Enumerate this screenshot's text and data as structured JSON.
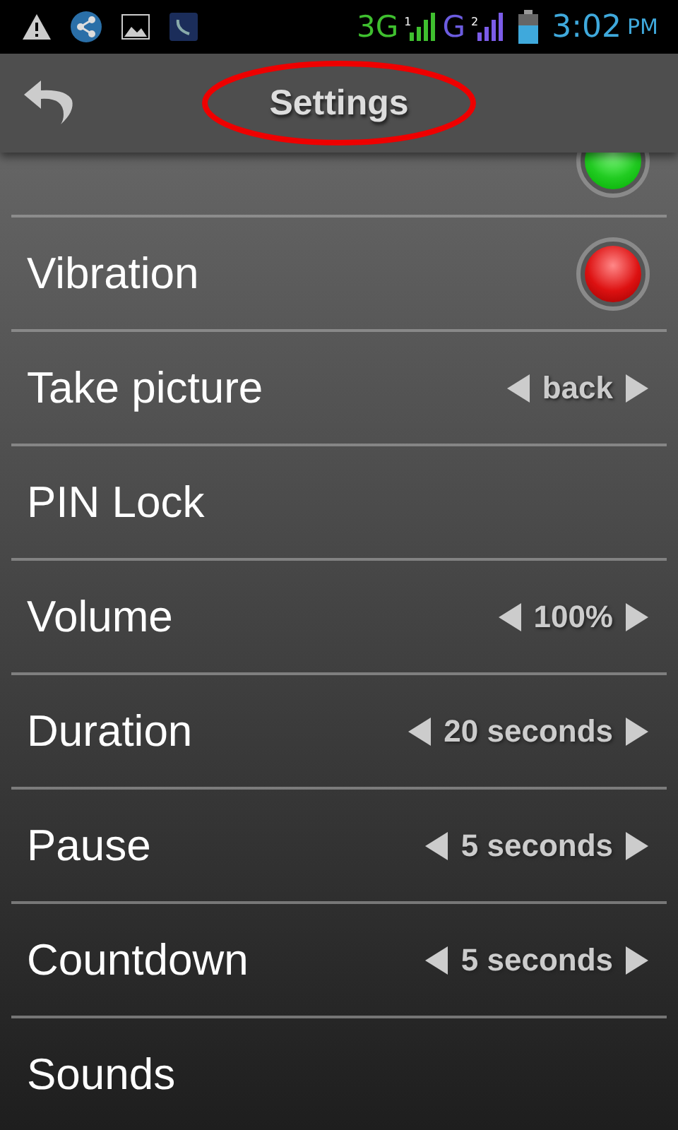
{
  "status_bar": {
    "network_1": "3G",
    "sim_1": "1",
    "network_2": "G",
    "sim_2": "2",
    "time": "3:02",
    "meridiem": "PM"
  },
  "header": {
    "title": "Settings",
    "title_circled": true
  },
  "settings": [
    {
      "kind": "toggle",
      "on": true
    },
    {
      "kind": "toggle",
      "label": "Vibration",
      "on": false
    },
    {
      "kind": "choice",
      "label": "Take picture",
      "value": "back"
    },
    {
      "kind": "link",
      "label": "PIN Lock"
    },
    {
      "kind": "choice",
      "label": "Volume",
      "value": "100%"
    },
    {
      "kind": "choice",
      "label": "Duration",
      "value": "20 seconds"
    },
    {
      "kind": "choice",
      "label": "Pause",
      "value": "5 seconds"
    },
    {
      "kind": "choice",
      "label": "Countdown",
      "value": "5 seconds"
    },
    {
      "kind": "link",
      "label": "Sounds"
    }
  ]
}
